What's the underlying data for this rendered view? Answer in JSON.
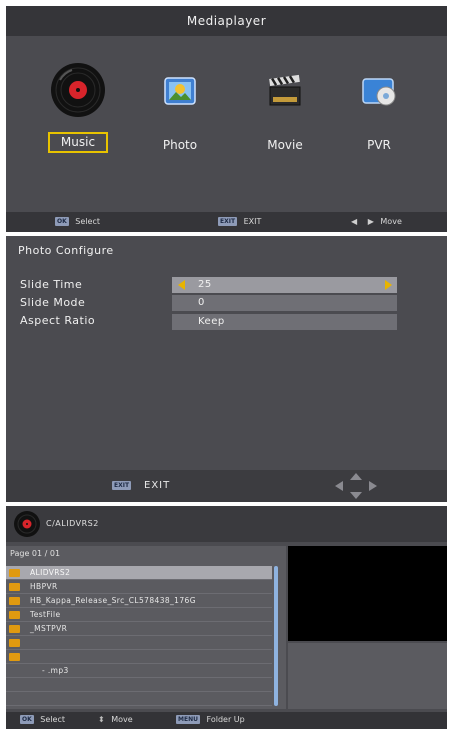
{
  "mediaplayer": {
    "title": "Mediaplayer",
    "items": [
      {
        "label": "Music",
        "icon": "music-disc-icon",
        "selected": true
      },
      {
        "label": "Photo",
        "icon": "photo-icon",
        "selected": false
      },
      {
        "label": "Movie",
        "icon": "clapperboard-icon",
        "selected": false
      },
      {
        "label": "PVR",
        "icon": "pvr-disc-icon",
        "selected": false
      }
    ],
    "footer": {
      "ok_key": "OK",
      "select_label": "Select",
      "exit_key": "EXIT",
      "exit_label": "EXIT",
      "move_label": "Move"
    }
  },
  "photo_config": {
    "title": "Photo Configure",
    "rows": [
      {
        "label": "Slide Time",
        "value": "25",
        "active": true
      },
      {
        "label": "Slide Mode",
        "value": "0",
        "active": false
      },
      {
        "label": "Aspect Ratio",
        "value": "Keep",
        "active": false
      }
    ],
    "footer": {
      "exit_key": "EXIT",
      "exit_label": "EXIT"
    }
  },
  "file_browser": {
    "path": "C/ALIDVRS2",
    "page": "Page  01 / 01",
    "files": [
      {
        "name": "ALIDVRS2",
        "type": "folder",
        "selected": true
      },
      {
        "name": "HBPVR",
        "type": "folder",
        "selected": false
      },
      {
        "name": "HB_Kappa_Release_Src_CL578438_176G",
        "type": "folder",
        "selected": false
      },
      {
        "name": "TestFile",
        "type": "folder",
        "selected": false
      },
      {
        "name": "_MSTPVR",
        "type": "folder",
        "selected": false
      },
      {
        "name": "",
        "type": "folder",
        "selected": false
      },
      {
        "name": "",
        "type": "folder",
        "selected": false
      },
      {
        "name": "-    .mp3",
        "type": "file",
        "selected": false
      },
      {
        "name": "",
        "type": "empty",
        "selected": false
      },
      {
        "name": "",
        "type": "empty",
        "selected": false
      }
    ],
    "footer": {
      "ok_key": "OK",
      "select_label": "Select",
      "move_label": "Move",
      "menu_key": "MENU",
      "folder_up_label": "Folder Up"
    }
  },
  "colors": {
    "highlight": "#e8c300",
    "arrow": "#e8b400",
    "folder": "#e09a10"
  }
}
